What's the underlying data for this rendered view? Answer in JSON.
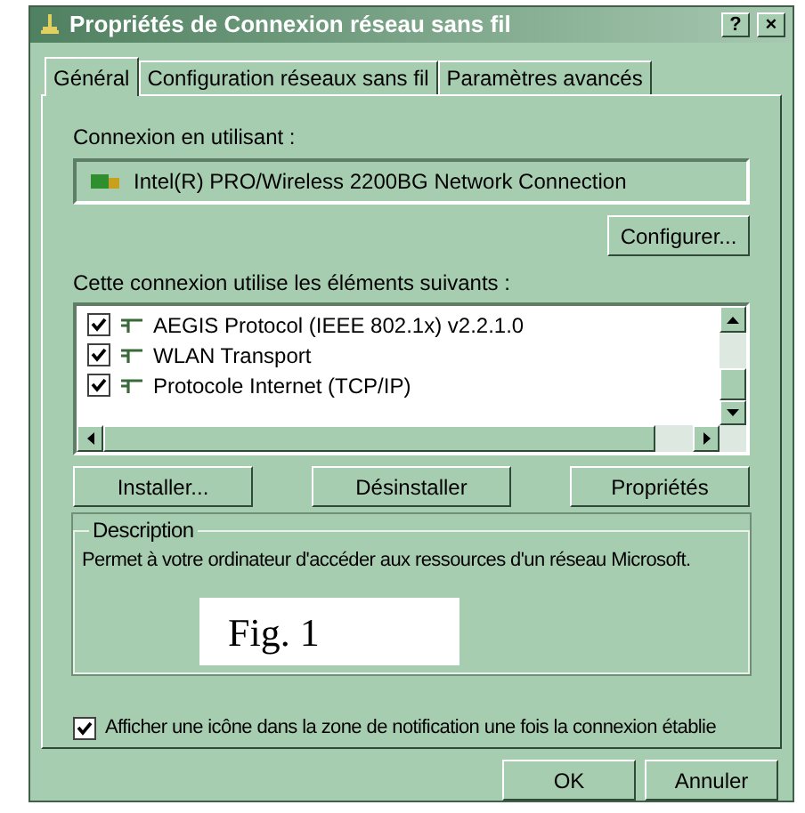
{
  "window": {
    "title": "Propriétés de Connexion réseau sans fil",
    "title_buttons": [
      "?",
      "×"
    ]
  },
  "tabs": [
    {
      "label": "Général",
      "selected": true
    },
    {
      "label": "Configuration réseaux sans fil",
      "selected": false
    },
    {
      "label": "Paramètres avancés",
      "selected": false
    }
  ],
  "adapter": {
    "label": "Connexion en utilisant :",
    "value": "Intel(R) PRO/Wireless 2200BG Network Connection"
  },
  "configure_button": "Configurer...",
  "components": {
    "label": "Cette connexion utilise les éléments suivants :",
    "items": [
      {
        "label": "AEGIS Protocol (IEEE 802.1x) v2.2.1.0",
        "checked": true
      },
      {
        "label": "WLAN Transport",
        "checked": true
      },
      {
        "label": "Protocole Internet (TCP/IP)",
        "checked": true
      }
    ]
  },
  "component_buttons": [
    "Installer...",
    "Désinstaller",
    "Propriétés"
  ],
  "description": {
    "title": "Description",
    "text": "Permet à votre ordinateur d'accéder aux ressources d'un réseau Microsoft."
  },
  "figure_label": "Fig. 1",
  "notify_option": {
    "label": "Afficher une icône dans la zone de notification une fois la connexion établie",
    "checked": true
  },
  "dialog_buttons": [
    "OK",
    "Annuler"
  ]
}
